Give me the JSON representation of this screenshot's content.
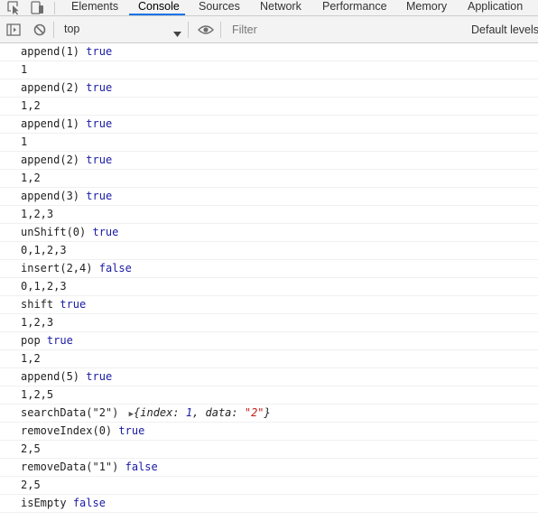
{
  "tabs": [
    {
      "label": "Elements",
      "active": false
    },
    {
      "label": "Console",
      "active": true
    },
    {
      "label": "Sources",
      "active": false
    },
    {
      "label": "Network",
      "active": false
    },
    {
      "label": "Performance",
      "active": false
    },
    {
      "label": "Memory",
      "active": false
    },
    {
      "label": "Application",
      "active": false
    }
  ],
  "toolbar": {
    "context": "top",
    "filter_placeholder": "Filter",
    "levels": "Default levels"
  },
  "icons": {
    "inspect": "inspect-element-icon",
    "device": "device-toolbar-icon",
    "sidebar": "console-sidebar-icon",
    "clear": "clear-console-icon",
    "dropdown": "chevron-down-icon",
    "live": "live-expression-eye-icon"
  },
  "colors": {
    "keyword": "#1a1aa6",
    "string": "#c41a16",
    "tab_underline": "#1a73e8"
  },
  "console": {
    "lines": [
      {
        "text": "append(1)",
        "value": "true"
      },
      {
        "text": "1",
        "value": ""
      },
      {
        "text": "append(2)",
        "value": "true"
      },
      {
        "text": "1,2",
        "value": ""
      },
      {
        "text": "append(1)",
        "value": "true"
      },
      {
        "text": "1",
        "value": ""
      },
      {
        "text": "append(2)",
        "value": "true"
      },
      {
        "text": "1,2",
        "value": ""
      },
      {
        "text": "append(3)",
        "value": "true"
      },
      {
        "text": "1,2,3",
        "value": ""
      },
      {
        "text": "unShift(0)",
        "value": "true"
      },
      {
        "text": "0,1,2,3",
        "value": ""
      },
      {
        "text": "insert(2,4)",
        "value": "false"
      },
      {
        "text": "0,1,2,3",
        "value": ""
      },
      {
        "text": "shift",
        "value": "true"
      },
      {
        "text": "1,2,3",
        "value": ""
      },
      {
        "text": "pop",
        "value": "true"
      },
      {
        "text": "1,2",
        "value": ""
      },
      {
        "text": "append(5)",
        "value": "true"
      },
      {
        "text": "1,2,5",
        "value": ""
      },
      {
        "text": "searchData(\"2\")",
        "object": {
          "index": "1",
          "data": "\"2\""
        }
      },
      {
        "text": "removeIndex(0)",
        "value": "true"
      },
      {
        "text": "2,5",
        "value": ""
      },
      {
        "text": "removeData(\"1\")",
        "value": "false"
      },
      {
        "text": "2,5",
        "value": ""
      },
      {
        "text": "isEmpty",
        "value": "false"
      }
    ]
  }
}
